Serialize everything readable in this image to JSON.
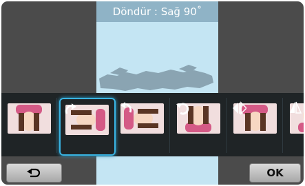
{
  "title": "Döndür : Sağ 90˚",
  "buttons": {
    "back_icon": "back-arrow-icon",
    "ok_label": "OK"
  },
  "effects": [
    {
      "name": "original",
      "icon": ""
    },
    {
      "name": "rotate-right-90",
      "icon": "rotate-right-icon",
      "selected": true
    },
    {
      "name": "rotate-left-90",
      "icon": "rotate-left-icon"
    },
    {
      "name": "rotate-180",
      "icon": "rotate-180-icon"
    },
    {
      "name": "flip-horizontal",
      "icon": "flip-horizontal-icon"
    },
    {
      "name": "flip-vertical",
      "icon": "flip-vertical-icon"
    }
  ],
  "colors": {
    "selection": "#3ab5e4",
    "title_bar": "#8fb3c6",
    "preview_bg": "#c4e5f3"
  }
}
